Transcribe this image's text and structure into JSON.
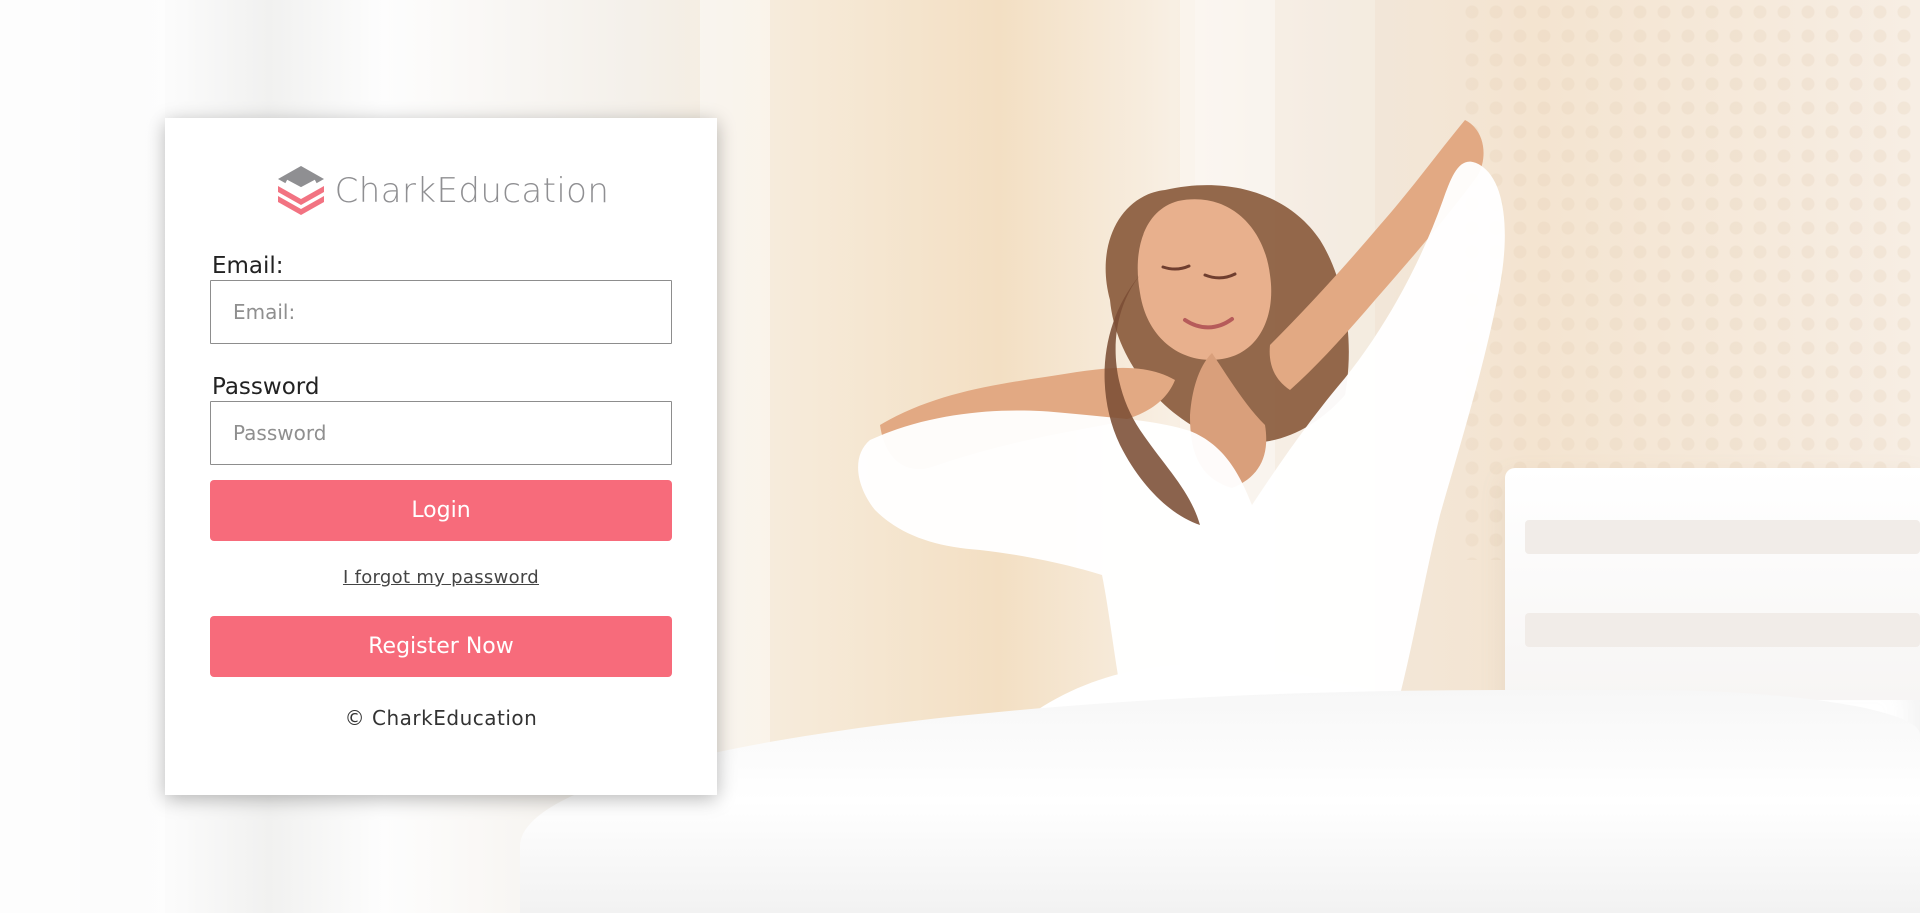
{
  "brand": {
    "name": "CharkEducation",
    "icon": "layered-stack-logo-icon",
    "colors": {
      "accent": "#f76b7b",
      "logo_gray": "#8f8f92",
      "logo_red": "#f27382"
    }
  },
  "form": {
    "email": {
      "label": "Email:",
      "placeholder": "Email:",
      "value": ""
    },
    "password": {
      "label": "Password",
      "placeholder": "Password",
      "value": ""
    },
    "login_label": "Login",
    "forgot_label": "I forgot my password",
    "register_label": "Register Now"
  },
  "footer": {
    "copyright": "© CharkEducation"
  }
}
